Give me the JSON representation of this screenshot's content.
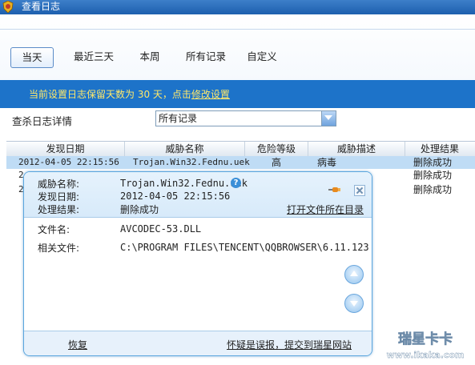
{
  "window": {
    "title": "查看日志"
  },
  "tabs": [
    {
      "label": "当天",
      "active": true
    },
    {
      "label": "最近三天"
    },
    {
      "label": "本周"
    },
    {
      "label": "所有记录"
    },
    {
      "label": "自定义"
    }
  ],
  "notice": {
    "prefix": "当前设置日志保留天数为 30 天，点击",
    "link": "修改设置"
  },
  "filter": {
    "label": "查杀日志详情",
    "selected": "所有记录"
  },
  "table": {
    "columns": [
      "发现日期",
      "威胁名称",
      "危险等级",
      "威胁描述",
      "处理结果"
    ],
    "rows": [
      {
        "date": "2012-04-05 22:15:56",
        "name": "Trojan.Win32.Fednu.uek",
        "level": "高",
        "desc": "病毒",
        "result": "删除成功"
      },
      {
        "date": "2",
        "name": "",
        "level": "",
        "desc": "",
        "result": "删除成功"
      },
      {
        "date": "2",
        "name": "",
        "level": "",
        "desc": "",
        "result": "删除成功"
      }
    ]
  },
  "popup": {
    "threat_name_label": "威胁名称:",
    "threat_name": "Trojan.Win32.Fednu.uek",
    "found_date_label": "发现日期:",
    "found_date": "2012-04-05 22:15:56",
    "result_label": "处理结果:",
    "result": "删除成功",
    "open_dir_link": "打开文件所在目录",
    "file_name_label": "文件名:",
    "file_name": "AVCODEC-53.DLL",
    "related_file_label": "相关文件:",
    "related_file": "C:\\PROGRAM FILES\\TENCENT\\QQBROWSER\\6.11.123",
    "restore_link": "恢复",
    "report_link": "怀疑是误报，提交到瑞星网站",
    "help_icon": "?"
  },
  "watermark": {
    "line1": "瑞星卡卡",
    "line2": "www.ikaka.com"
  },
  "colors": {
    "notice_bg": "#1d73c9",
    "notice_text": "#ffe86a",
    "titlebar": "#2a6dbb"
  }
}
